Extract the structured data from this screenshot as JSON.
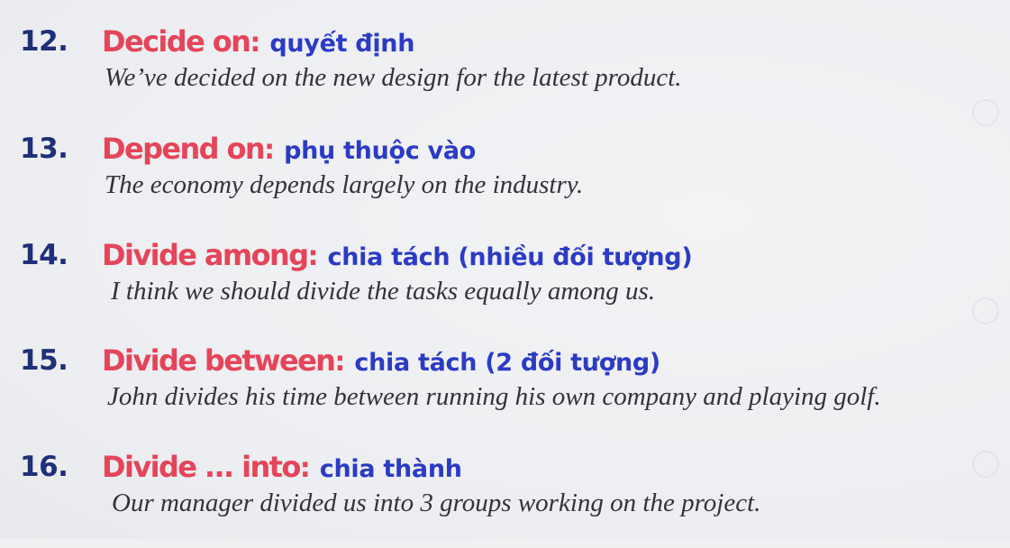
{
  "entries": [
    {
      "number": "12.",
      "phrase": "Decide on",
      "colon": ":",
      "meaning": "quyết định",
      "example": "We’ve decided on the new design for the latest product."
    },
    {
      "number": "13.",
      "phrase": "Depend on",
      "colon": ":",
      "meaning": "phụ thuộc vào",
      "example": "The economy depends largely on the industry."
    },
    {
      "number": "14.",
      "phrase": "Divide among",
      "colon": ":",
      "meaning": "chia tách (nhiều đối tượng)",
      "example": "I think we should divide the tasks equally among us."
    },
    {
      "number": "15.",
      "phrase": "Divide between",
      "colon": ":",
      "meaning": "chia tách (2 đối tượng)",
      "example": "John divides his time between running his own company and playing golf."
    },
    {
      "number": "16.",
      "phrase": "Divide ... into",
      "colon": ":",
      "meaning": "chia thành",
      "example": "Our manager divided us into 3 groups working on the project."
    }
  ]
}
